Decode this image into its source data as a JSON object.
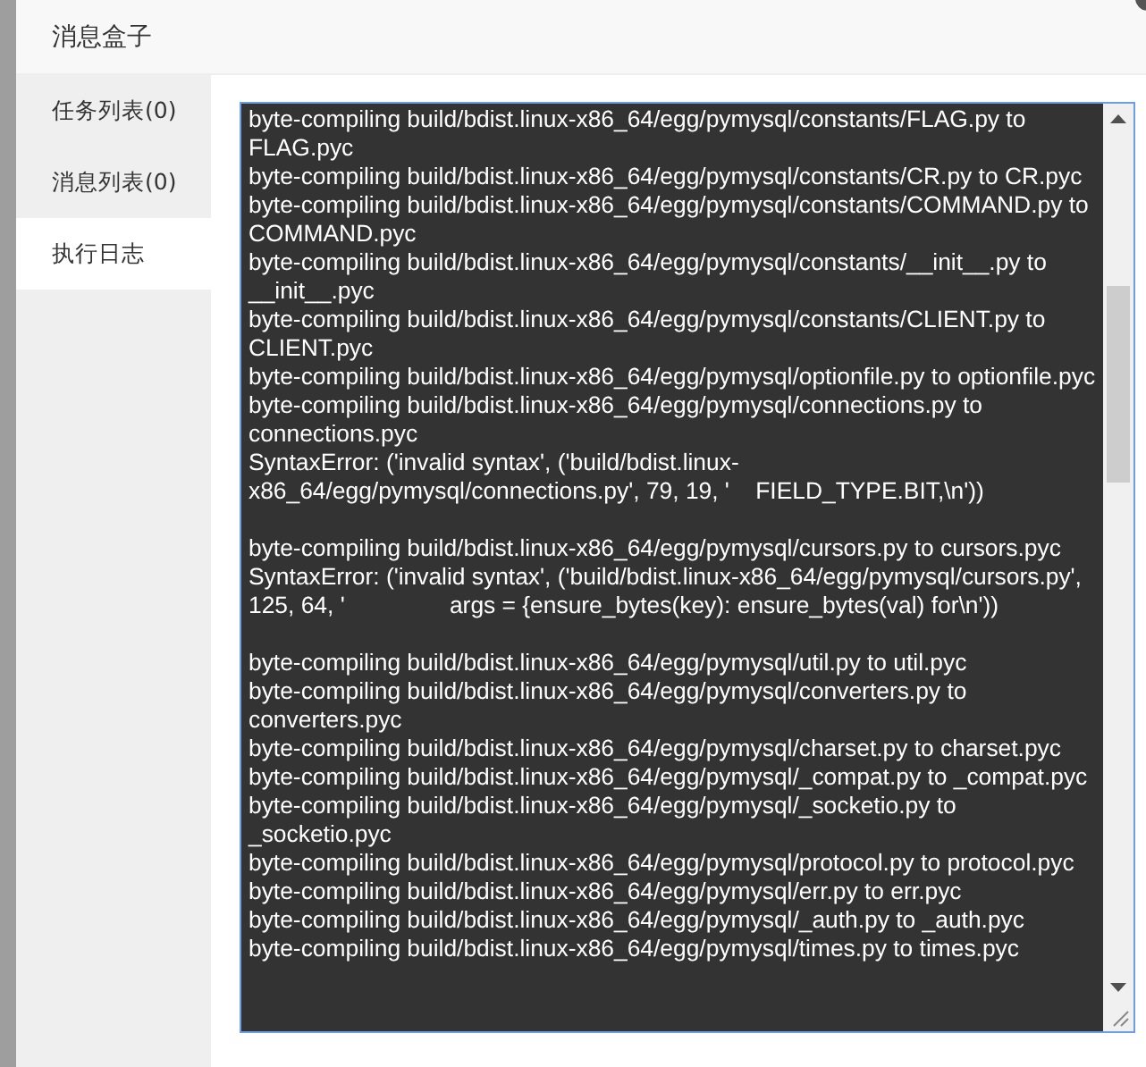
{
  "dialog": {
    "title": "消息盒子"
  },
  "tabs": [
    {
      "label": "任务列表(0)",
      "selected": false
    },
    {
      "label": "消息列表(0)",
      "selected": false
    },
    {
      "label": "执行日志",
      "selected": true
    }
  ],
  "log_blocks": [
    [
      "byte-compiling build/bdist.linux-x86_64/egg/pymysql/constants/FLAG.py to FLAG.pyc",
      "byte-compiling build/bdist.linux-x86_64/egg/pymysql/constants/CR.py to CR.pyc",
      "byte-compiling build/bdist.linux-x86_64/egg/pymysql/constants/COMMAND.py to COMMAND.pyc",
      "byte-compiling build/bdist.linux-x86_64/egg/pymysql/constants/__init__.py to __init__.pyc",
      "byte-compiling build/bdist.linux-x86_64/egg/pymysql/constants/CLIENT.py to CLIENT.pyc",
      "byte-compiling build/bdist.linux-x86_64/egg/pymysql/optionfile.py to optionfile.pyc",
      "byte-compiling build/bdist.linux-x86_64/egg/pymysql/connections.py to connections.pyc",
      "SyntaxError: ('invalid syntax', ('build/bdist.linux-x86_64/egg/pymysql/connections.py', 79, 19, '    FIELD_TYPE.BIT,\\n'))"
    ],
    [
      "byte-compiling build/bdist.linux-x86_64/egg/pymysql/cursors.py to cursors.pyc",
      "SyntaxError: ('invalid syntax', ('build/bdist.linux-x86_64/egg/pymysql/cursors.py', 125, 64, '                args = {ensure_bytes(key): ensure_bytes(val) for\\n'))"
    ],
    [
      "byte-compiling build/bdist.linux-x86_64/egg/pymysql/util.py to util.pyc",
      "byte-compiling build/bdist.linux-x86_64/egg/pymysql/converters.py to converters.pyc",
      "byte-compiling build/bdist.linux-x86_64/egg/pymysql/charset.py to charset.pyc",
      "byte-compiling build/bdist.linux-x86_64/egg/pymysql/_compat.py to _compat.pyc",
      "byte-compiling build/bdist.linux-x86_64/egg/pymysql/_socketio.py to _socketio.pyc",
      "byte-compiling build/bdist.linux-x86_64/egg/pymysql/protocol.py to protocol.pyc",
      "byte-compiling build/bdist.linux-x86_64/egg/pymysql/err.py to err.pyc",
      "byte-compiling build/bdist.linux-x86_64/egg/pymysql/_auth.py to _auth.pyc",
      "byte-compiling build/bdist.linux-x86_64/egg/pymysql/times.py to times.pyc"
    ]
  ]
}
